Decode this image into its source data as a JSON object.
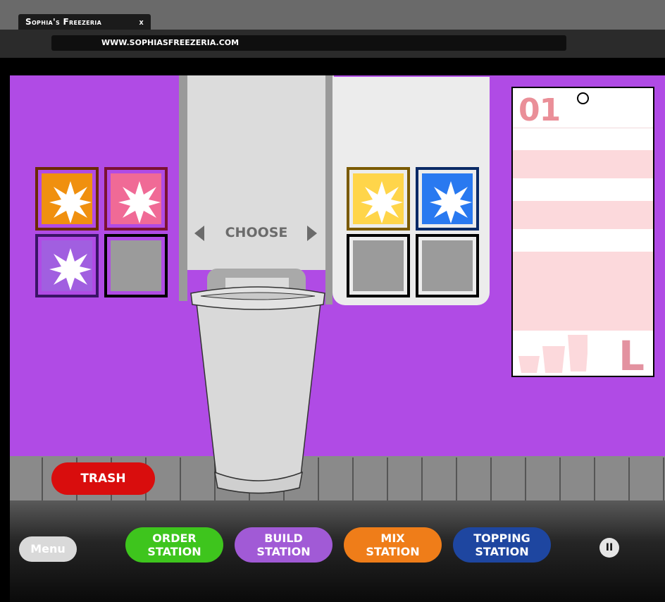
{
  "browser": {
    "tab_title": "Sophia's Freezeria",
    "tab_close": "x",
    "url": "WWW.SOPHIASFREEZERIA.COM"
  },
  "machine": {
    "choose_label": "CHOOSE"
  },
  "flavors_left": [
    {
      "name": "orange-flavor",
      "color": "#f0900f",
      "empty": false
    },
    {
      "name": "pink-flavor",
      "color": "#f06a96",
      "empty": false
    },
    {
      "name": "purple-flavor",
      "color": "#a15fe0",
      "empty": false
    },
    {
      "name": "empty-slot",
      "color": "#9b9b9b",
      "empty": true
    }
  ],
  "flavors_right": [
    {
      "name": "yellow-flavor",
      "color": "#ffd54a",
      "empty": false
    },
    {
      "name": "blue-flavor",
      "color": "#2979f0",
      "empty": false
    },
    {
      "name": "empty-slot",
      "color": "#9b9b9b",
      "empty": true
    },
    {
      "name": "empty-slot",
      "color": "#9b9b9b",
      "empty": true
    }
  ],
  "ticket": {
    "number": "01",
    "size": "L"
  },
  "buttons": {
    "trash": "TRASH",
    "menu": "Menu",
    "pause": "II"
  },
  "stations": [
    {
      "line1": "ORDER",
      "line2": "STATION",
      "color": "#3ec51d"
    },
    {
      "line1": "BUILD",
      "line2": "STATION",
      "color": "#a15ad6"
    },
    {
      "line1": "MIX",
      "line2": "STATION",
      "color": "#ef7d19"
    },
    {
      "line1": "TOPPING",
      "line2": "STATION",
      "color": "#1e46a0"
    }
  ]
}
